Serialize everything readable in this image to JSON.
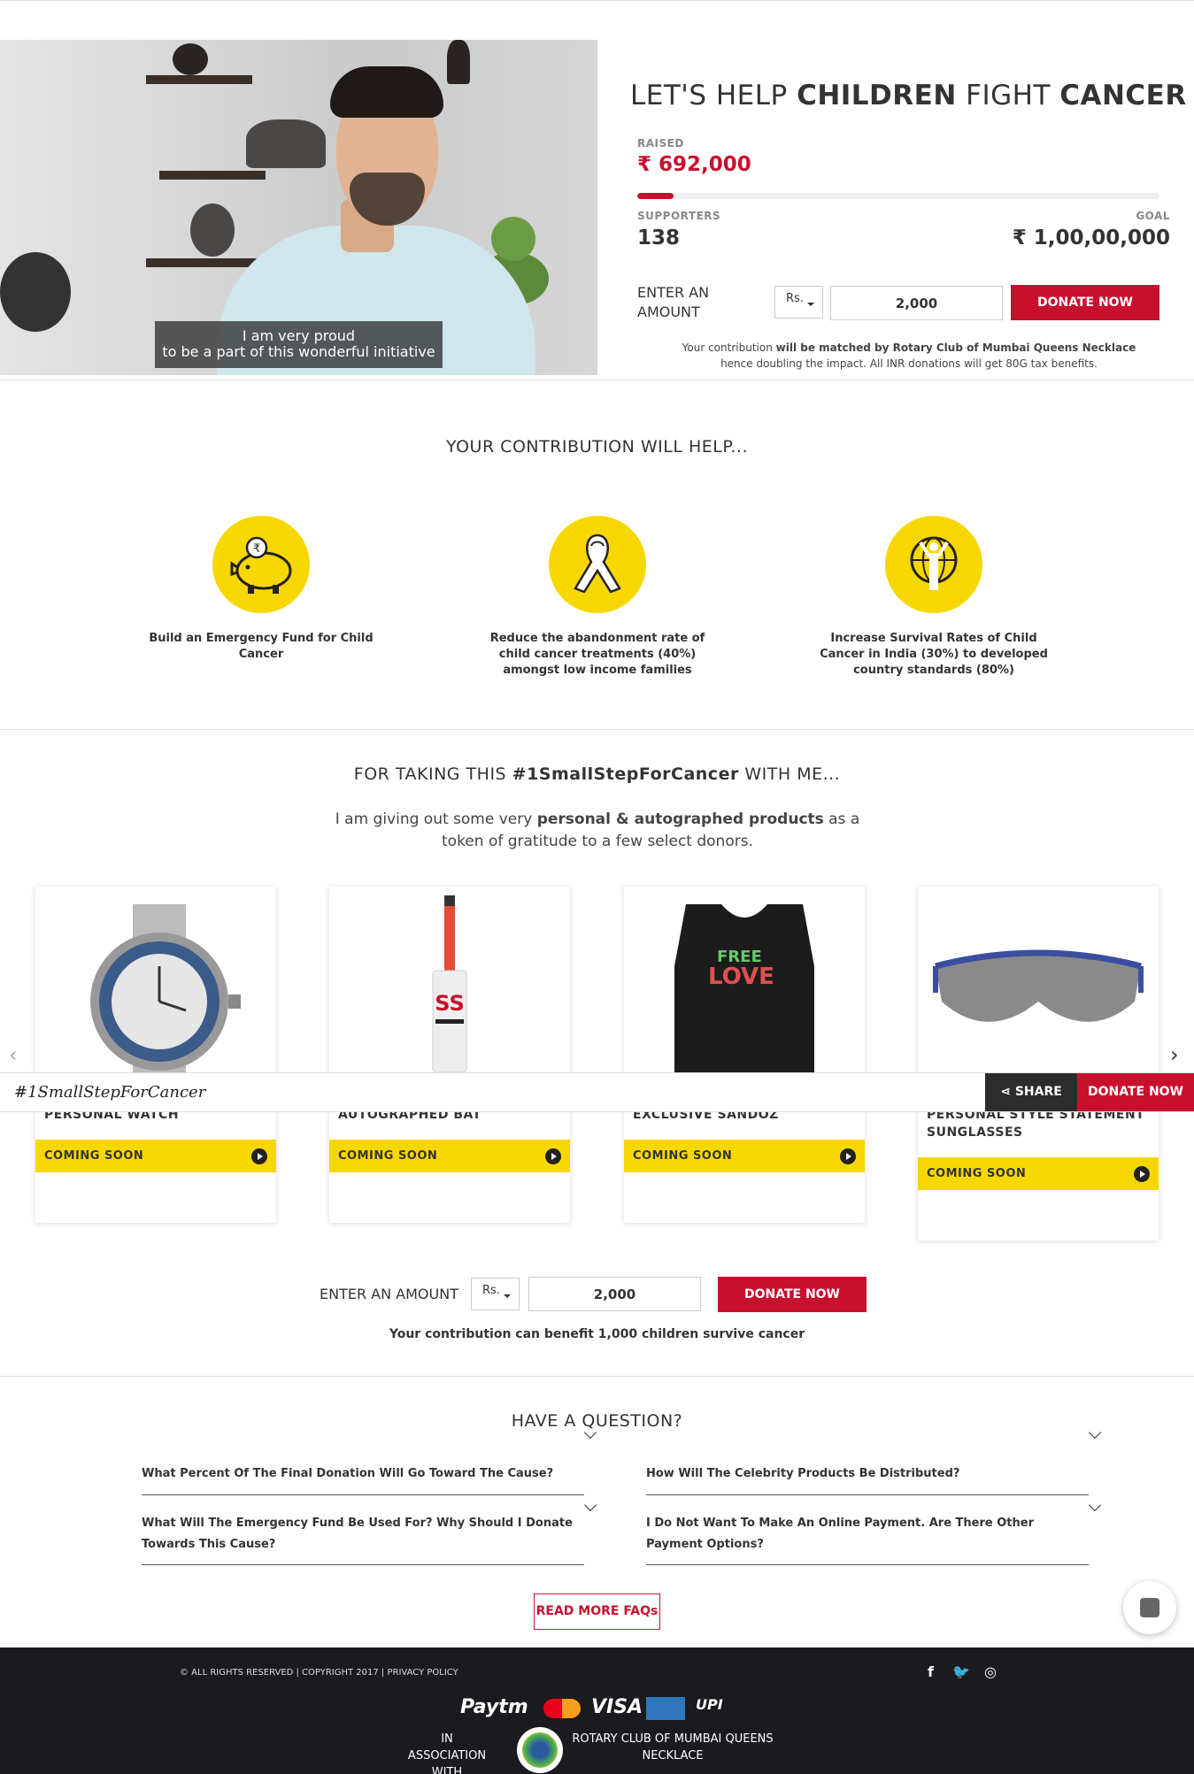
{
  "hero": {
    "video_caption_line1": "I am very proud",
    "video_caption_line2": "to be a part of this wonderful initiative",
    "title_pre": "LET'S HELP ",
    "title_b1": "CHILDREN",
    "title_mid": " FIGHT ",
    "title_b2": "CANCER",
    "raised_label": "RAISED",
    "raised_value": "₹ 692,000",
    "raised_progress_fraction": 0.0692,
    "supporters_label": "SUPPORTERS",
    "supporters_value": "138",
    "goal_label": "GOAL",
    "goal_value": "₹ 1,00,00,000",
    "enter_amount_label": "ENTER AN AMOUNT",
    "currency": "Rs.",
    "amount_value": "2,000",
    "donate_label": "DONATE NOW",
    "note_pre": "Your contribution ",
    "note_bold": "will be matched by Rotary Club of Mumbai Queens Necklace",
    "note_post": " hence doubling the impact. All INR donations will get 80G tax benefits."
  },
  "help": {
    "title": "YOUR CONTRIBUTION WILL HELP...",
    "items": [
      {
        "icon": "piggy-bank-icon",
        "text": "Build an Emergency Fund for Child Cancer"
      },
      {
        "icon": "awareness-ribbon-icon",
        "text": "Reduce the abandonment rate of child cancer treatments (40%) amongst low income families"
      },
      {
        "icon": "globe-child-icon",
        "text": "Increase Survival Rates of Child Cancer in India (30%) to developed country standards (80%)"
      }
    ]
  },
  "products": {
    "title_pre": "FOR TAKING THIS ",
    "title_bold": "#1SmallStepForCancer",
    "title_post": " WITH ME...",
    "intro_pre": "I am giving out some very ",
    "intro_bold": "personal & autographed products",
    "intro_post": " as a token of gratitude to a few select donors.",
    "items": [
      {
        "name": "PERSONAL WATCH",
        "status": "COMING SOON"
      },
      {
        "name": "AUTOGRAPHED BAT",
        "status": "COMING SOON"
      },
      {
        "name": "EXCLUSIVE SANDOZ",
        "status": "COMING SOON"
      },
      {
        "name": "PERSONAL STYLE STATEMENT SUNGLASSES",
        "status": "COMING SOON"
      }
    ],
    "tshirt_text_top": "FREE",
    "tshirt_text_main": "LOVE"
  },
  "share_bar": {
    "hashtag": "#1SmallStepForCancer",
    "share_label": "SHARE",
    "donate_label": "DONATE NOW"
  },
  "mid_donate": {
    "enter_amount_label": "ENTER AN AMOUNT",
    "currency": "Rs.",
    "amount_value": "2,000",
    "donate_label": "DONATE NOW",
    "benefit_text": "Your contribution can benefit 1,000 children survive cancer"
  },
  "faq": {
    "title": "HAVE A QUESTION?",
    "questions": [
      "What Percent Of The Final Donation Will Go Toward The Cause?",
      "How Will The Celebrity Products Be Distributed?",
      "What Will The Emergency Fund Be Used For? Why Should I Donate Towards This Cause?",
      "I Do Not Want To Make An Online Payment. Are There Other Payment Options?"
    ],
    "read_more": "READ MORE FAQs"
  },
  "footer": {
    "copyright": "© ALL RIGHTS RESERVED | COPYRIGHT 2017 | PRIVACY POLICY",
    "social": [
      "facebook-icon",
      "twitter-icon",
      "instagram-icon"
    ],
    "payments": [
      "Paytm",
      "MasterCard",
      "VISA",
      "AMERICAN EXPRESS",
      "UPI"
    ],
    "assoc_left": "IN ASSOCIATION WITH",
    "assoc_right": "ROTARY CLUB OF MUMBAI QUEENS NECKLACE"
  },
  "colors": {
    "brand_red": "#c8102e",
    "accent_yellow": "#f7d700",
    "footer_bg": "#1a1a1f"
  }
}
